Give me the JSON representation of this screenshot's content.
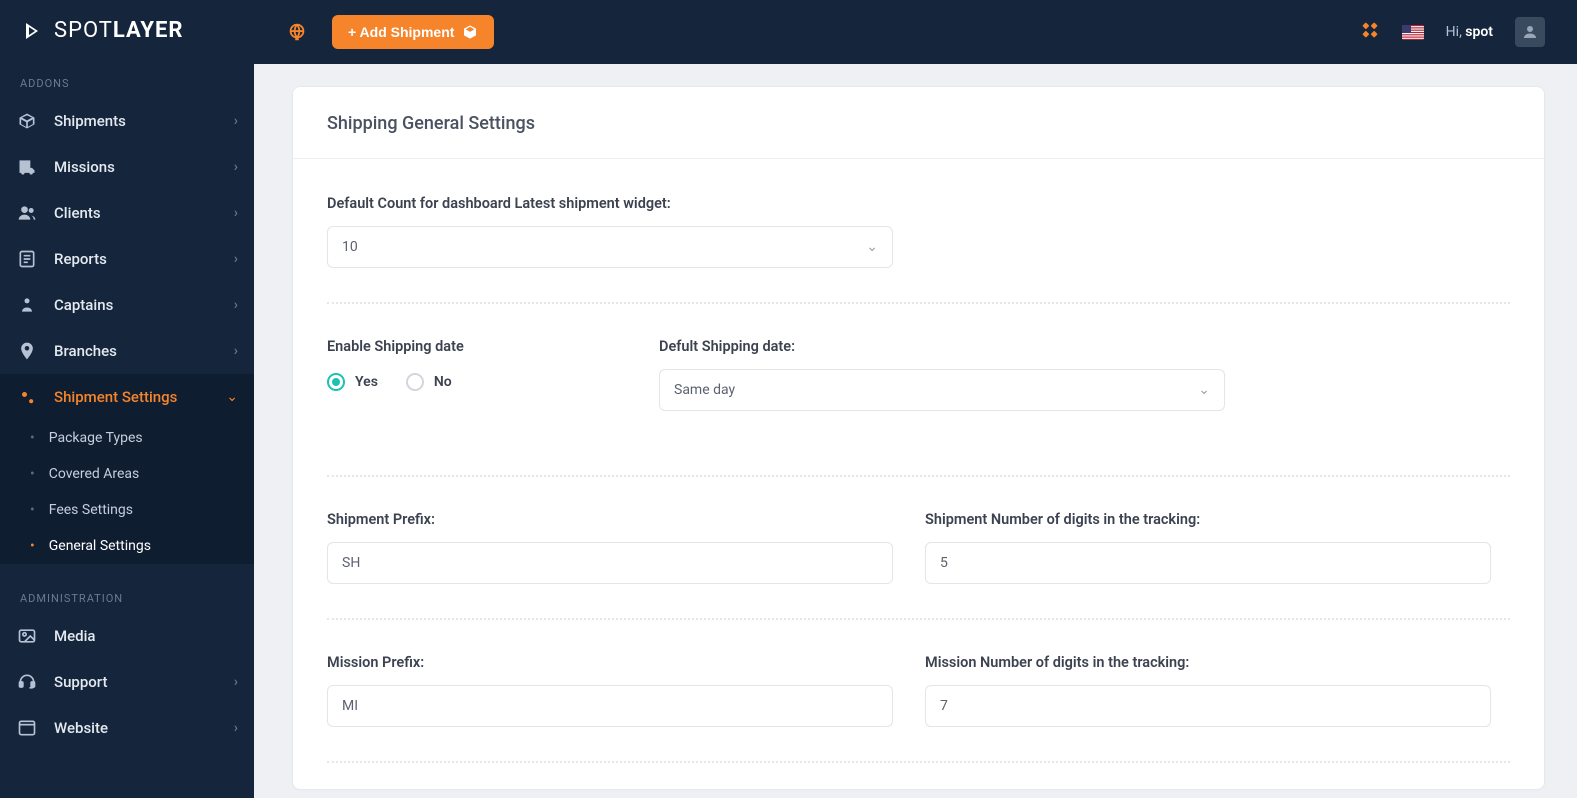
{
  "brand": {
    "light": "SPOT",
    "bold": "LAYER"
  },
  "sidebar": {
    "section_addons": "ADDONS",
    "section_admin": "ADMINISTRATION",
    "items": {
      "shipments": "Shipments",
      "missions": "Missions",
      "clients": "Clients",
      "reports": "Reports",
      "captains": "Captains",
      "branches": "Branches",
      "shipment_settings": "Shipment Settings",
      "media": "Media",
      "support": "Support",
      "website": "Website"
    },
    "sub_items": {
      "package_types": "Package Types",
      "covered_areas": "Covered Areas",
      "fees_settings": "Fees Settings",
      "general_settings": "General Settings"
    }
  },
  "topbar": {
    "add_shipment": "+ Add Shipment",
    "greeting_prefix": "Hi, ",
    "greeting_name": "spot"
  },
  "page": {
    "title": "Shipping General Settings",
    "labels": {
      "default_count": "Default Count for dashboard Latest shipment widget:",
      "enable_shipping_date": "Enable Shipping date",
      "default_shipping_date": "Defult Shipping date:",
      "shipment_prefix": "Shipment Prefix:",
      "shipment_digits": "Shipment Number of digits in the tracking:",
      "mission_prefix": "Mission Prefix:",
      "mission_digits": "Mission Number of digits in the tracking:"
    },
    "values": {
      "default_count": "10",
      "default_shipping_date": "Same day",
      "shipment_prefix": "SH",
      "shipment_digits": "5",
      "mission_prefix": "MI",
      "mission_digits": "7"
    },
    "radio": {
      "yes": "Yes",
      "no": "No"
    }
  }
}
